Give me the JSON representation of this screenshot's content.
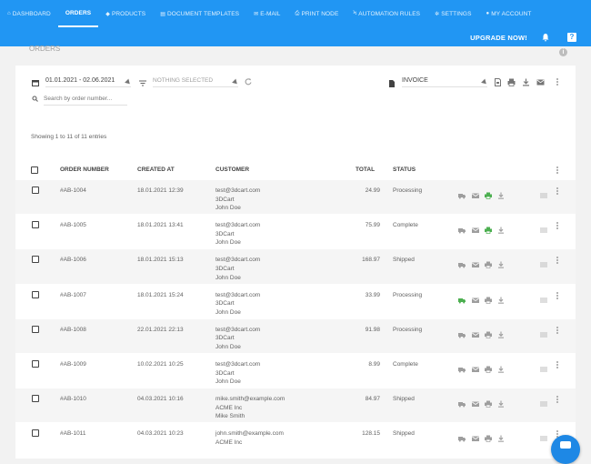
{
  "nav": {
    "items": [
      {
        "label": "DASHBOARD",
        "icon": "home-icon"
      },
      {
        "label": "ORDERS",
        "icon": "none",
        "active": true
      },
      {
        "label": "PRODUCTS",
        "icon": "tag-icon"
      },
      {
        "label": "DOCUMENT TEMPLATES",
        "icon": "document-icon"
      },
      {
        "label": "E-MAIL",
        "icon": "mail-icon"
      },
      {
        "label": "PRINT NODE",
        "icon": "printer-icon"
      },
      {
        "label": "AUTOMATION RULES",
        "icon": "bolt-icon"
      },
      {
        "label": "SETTINGS",
        "icon": "gear-icon"
      },
      {
        "label": "MY ACCOUNT",
        "icon": "user-icon"
      }
    ],
    "upgrade_label": "UPGRADE NOW!",
    "help_label": "?",
    "accent": "#2196f3"
  },
  "page": {
    "title": "ORDERS"
  },
  "filters": {
    "date_range": "01.01.2021 - 02.06.2021",
    "status_placeholder": "NOTHING SELECTED",
    "search_placeholder": "Search by order number...",
    "document_type": "INVOICE"
  },
  "table": {
    "showing": "Showing 1 to 11 of 11 entries",
    "headers": {
      "order_number": "ORDER NUMBER",
      "created_at": "CREATED AT",
      "customer": "CUSTOMER",
      "total": "TOTAL",
      "status": "STATUS"
    },
    "rows": [
      {
        "order": "#AB-1004",
        "created": "18.01.2021 12:39",
        "email": "test@3dcart.com",
        "company": "3DCart",
        "name": "John Doe",
        "total": "24.99",
        "status": "Processing",
        "truck_active": false,
        "print_active": true
      },
      {
        "order": "#AB-1005",
        "created": "18.01.2021 13:41",
        "email": "test@3dcart.com",
        "company": "3DCart",
        "name": "John Doe",
        "total": "75.99",
        "status": "Complete",
        "truck_active": false,
        "print_active": true
      },
      {
        "order": "#AB-1006",
        "created": "18.01.2021 15:13",
        "email": "test@3dcart.com",
        "company": "3DCart",
        "name": "John Doe",
        "total": "168.97",
        "status": "Shipped",
        "truck_active": false,
        "print_active": false
      },
      {
        "order": "#AB-1007",
        "created": "18.01.2021 15:24",
        "email": "test@3dcart.com",
        "company": "3DCart",
        "name": "John Doe",
        "total": "33.99",
        "status": "Processing",
        "truck_active": true,
        "print_active": false
      },
      {
        "order": "#AB-1008",
        "created": "22.01.2021 22:13",
        "email": "test@3dcart.com",
        "company": "3DCart",
        "name": "John Doe",
        "total": "91.98",
        "status": "Processing",
        "truck_active": false,
        "print_active": false
      },
      {
        "order": "#AB-1009",
        "created": "10.02.2021 10:25",
        "email": "test@3dcart.com",
        "company": "3DCart",
        "name": "John Doe",
        "total": "8.99",
        "status": "Complete",
        "truck_active": false,
        "print_active": false
      },
      {
        "order": "#AB-1010",
        "created": "04.03.2021 10:16",
        "email": "mike.smith@example.com",
        "company": "ACME Inc",
        "name": "Mike Smith",
        "total": "84.97",
        "status": "Shipped",
        "truck_active": false,
        "print_active": false
      },
      {
        "order": "#AB-1011",
        "created": "04.03.2021 10:23",
        "email": "john.smith@example.com",
        "company": "ACME Inc",
        "name": "",
        "total": "128.15",
        "status": "Shipped",
        "truck_active": false,
        "print_active": false
      }
    ]
  },
  "colors": {
    "green": "#4caf50",
    "grey_icon": "#9e9e9e",
    "row_alt": "#f5f5f5"
  }
}
